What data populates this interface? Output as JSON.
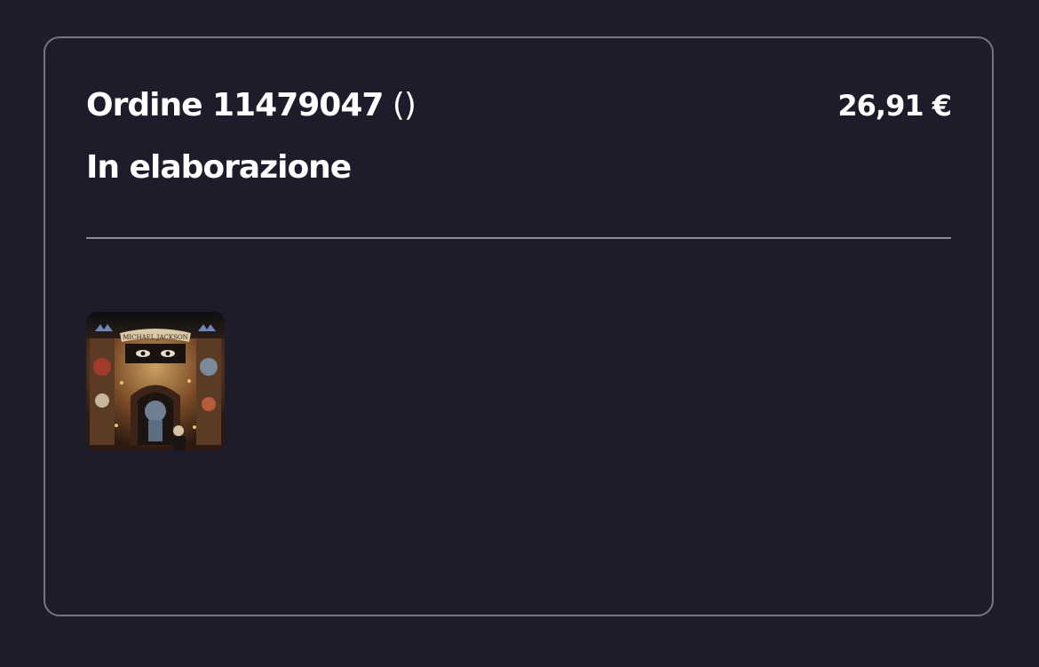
{
  "order": {
    "title_prefix": "Ordine 11479047",
    "title_suffix": " ()",
    "total": "26,91 €",
    "status": "In elaborazione",
    "items": [
      {
        "thumbnail_icon": "album-cover-image",
        "cover_text": "MICHAEL JACKSON"
      }
    ]
  },
  "colors": {
    "background": "#1e1b2a",
    "card_border": "#77757f",
    "divider": "#8d8b94",
    "text": "#ffffff"
  }
}
